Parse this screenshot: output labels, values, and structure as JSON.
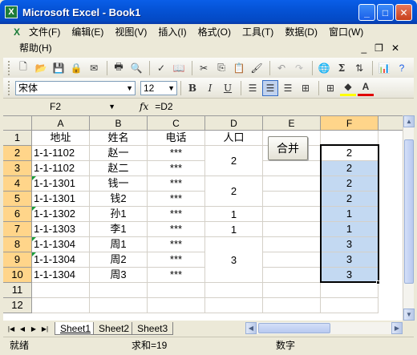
{
  "window": {
    "title": "Microsoft Excel - Book1",
    "app_icon": "X"
  },
  "menu": {
    "items": [
      "文件(F)",
      "编辑(E)",
      "视图(V)",
      "插入(I)",
      "格式(O)",
      "工具(T)",
      "数据(D)",
      "窗口(W)"
    ],
    "help": "帮助(H)"
  },
  "toolbar": {
    "font_name": "宋体",
    "font_size": "12",
    "bold": "B",
    "italic": "I",
    "underline": "U",
    "sigma": "Σ"
  },
  "formula_bar": {
    "name_box": "F2",
    "fx": "fx",
    "content": "=D2"
  },
  "columns": [
    "A",
    "B",
    "C",
    "D",
    "E",
    "F"
  ],
  "rows": [
    "1",
    "2",
    "3",
    "4",
    "5",
    "6",
    "7",
    "8",
    "9",
    "10",
    "11",
    "12"
  ],
  "header_row": {
    "a": "地址",
    "b": "姓名",
    "c": "电话",
    "d": "人口"
  },
  "data_rows": [
    {
      "a": "1-1-1102",
      "b": "赵一",
      "c": "***",
      "f": "2"
    },
    {
      "a": "1-1-1102",
      "b": "赵二",
      "c": "***",
      "f": "2"
    },
    {
      "a": "1-1-1301",
      "b": "钱一",
      "c": "***",
      "f": "2"
    },
    {
      "a": "1-1-1301",
      "b": "钱2",
      "c": "***",
      "f": "2"
    },
    {
      "a": "1-1-1302",
      "b": "孙1",
      "c": "***",
      "f": "1"
    },
    {
      "a": "1-1-1303",
      "b": "李1",
      "c": "***",
      "f": "1"
    },
    {
      "a": "1-1-1304",
      "b": "周1",
      "c": "***",
      "f": "3"
    },
    {
      "a": "1-1-1304",
      "b": "周2",
      "c": "***",
      "f": "3"
    },
    {
      "a": "1-1-1304",
      "b": "周3",
      "c": "***",
      "f": "3"
    }
  ],
  "merged_d": [
    "2",
    "2",
    "1",
    "1",
    "3"
  ],
  "merge_button": "合并",
  "sheets": [
    "Sheet1",
    "Sheet2",
    "Sheet3"
  ],
  "status": {
    "ready": "就绪",
    "sum": "求和=19",
    "mode": "数字"
  },
  "colors": {
    "selection": "#c3d9f2",
    "header_selected": "#ffd58a",
    "title_blue": "#0553d6"
  }
}
